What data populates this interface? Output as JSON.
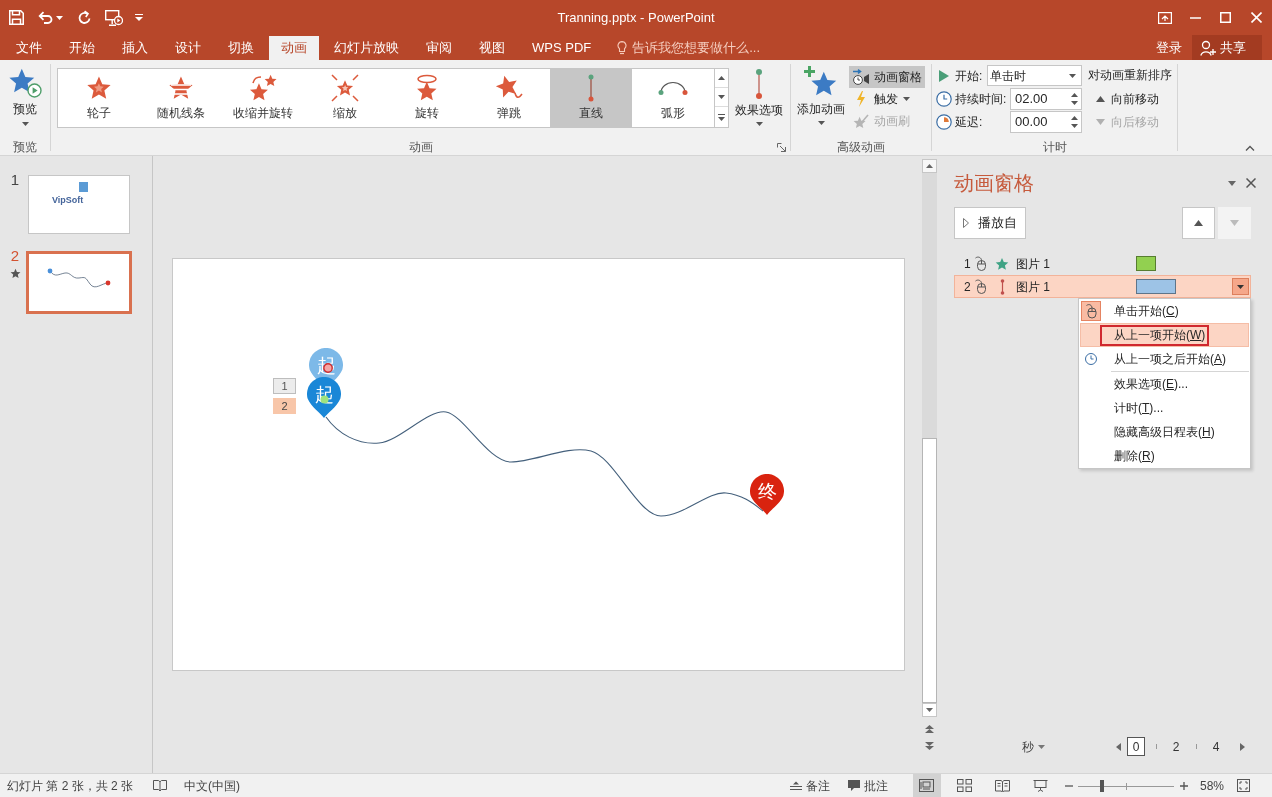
{
  "title_bar": {
    "title": "Tranning.pptx - PowerPoint"
  },
  "tabs": [
    {
      "label": "文件",
      "selected": false
    },
    {
      "label": "开始",
      "selected": false
    },
    {
      "label": "插入",
      "selected": false
    },
    {
      "label": "设计",
      "selected": false
    },
    {
      "label": "切换",
      "selected": false
    },
    {
      "label": "动画",
      "selected": true
    },
    {
      "label": "幻灯片放映",
      "selected": false
    },
    {
      "label": "审阅",
      "selected": false
    },
    {
      "label": "视图",
      "selected": false
    },
    {
      "label": "WPS PDF",
      "selected": false
    }
  ],
  "tell_me": {
    "placeholder": "告诉我您想要做什么..."
  },
  "account": {
    "sign_in": "登录",
    "share": "共享"
  },
  "ribbon": {
    "preview": {
      "button": "预览",
      "group_label": "预览"
    },
    "animation": {
      "effects": [
        {
          "kind": "wheel",
          "label": "轮子",
          "selected": false
        },
        {
          "kind": "bars",
          "label": "随机线条",
          "selected": false
        },
        {
          "kind": "shrink",
          "label": "收缩并旋转",
          "selected": false
        },
        {
          "kind": "zoom",
          "label": "缩放",
          "selected": false
        },
        {
          "kind": "spin",
          "label": "旋转",
          "selected": false
        },
        {
          "kind": "bounce",
          "label": "弹跳",
          "selected": false
        },
        {
          "kind": "line",
          "label": "直线",
          "selected": true
        },
        {
          "kind": "arc",
          "label": "弧形",
          "selected": false
        }
      ],
      "effect_options": "效果选项",
      "group_label": "动画"
    },
    "advanced": {
      "add_animation": "添加动画",
      "tools": [
        {
          "kind": "pane",
          "label": "动画窗格",
          "on": true,
          "disabled": false
        },
        {
          "kind": "trigger",
          "label": "触发",
          "on": false,
          "disabled": false
        },
        {
          "kind": "painter",
          "label": "动画刷",
          "on": false,
          "disabled": true
        }
      ],
      "group_label": "高级动画"
    },
    "timing": {
      "fields": [
        {
          "kind": "start",
          "label": "开始:",
          "value": "单击时"
        },
        {
          "kind": "duration",
          "label": "持续时间:",
          "value": "02.00"
        },
        {
          "kind": "delay",
          "label": "延迟:",
          "value": "00.00"
        }
      ],
      "reorder_title": "对动画重新排序",
      "reorder": [
        {
          "kind": "earlier",
          "label": "向前移动",
          "disabled": false
        },
        {
          "kind": "later",
          "label": "向后移动",
          "disabled": true
        }
      ],
      "group_label": "计时"
    }
  },
  "slides": [
    {
      "number": "1",
      "selected": false,
      "animated": false,
      "kind": "title",
      "text": "VipSoft"
    },
    {
      "number": "2",
      "selected": true,
      "animated": true,
      "kind": "path"
    }
  ],
  "slide": {
    "tags": [
      {
        "number": "1",
        "selected": false
      },
      {
        "number": "2",
        "selected": true
      }
    ],
    "markers": [
      {
        "kind": "start",
        "label": "起",
        "dimmed": true
      },
      {
        "kind": "start",
        "label": "起",
        "dimmed": false
      },
      {
        "kind": "end",
        "label": "终",
        "dimmed": false
      }
    ]
  },
  "animation_pane": {
    "title": "动画窗格",
    "play_from": "播放自",
    "move_up_disabled": false,
    "move_down_disabled": true,
    "items": [
      {
        "number": "1",
        "kind": "emphasis",
        "name": "图片 1",
        "color": "#92d050",
        "level": 0.25,
        "selected": false
      },
      {
        "number": "2",
        "kind": "path",
        "name": "图片 1",
        "color": "#9dc3e6",
        "level": 0.5,
        "selected": true
      }
    ],
    "context_menu": {
      "sections": [
        [
          {
            "kind": "click",
            "text": "单击开始(",
            "key": "C",
            "text_after": ")",
            "checked": true,
            "selected": false,
            "annotated": false
          },
          {
            "kind": "with",
            "text": "从上一项开始(",
            "key": "W",
            "text_after": ")",
            "checked": false,
            "selected": true,
            "annotated": true
          },
          {
            "kind": "after",
            "text": "从上一项之后开始(",
            "key": "A",
            "text_after": ")",
            "checked": false,
            "selected": false,
            "annotated": false
          }
        ],
        [
          {
            "kind": "command",
            "text": "效果选项(",
            "key": "E",
            "text_after": ")...",
            "checked": false,
            "selected": false,
            "annotated": false
          },
          {
            "kind": "command",
            "text": "计时(",
            "key": "T",
            "text_after": ")...",
            "checked": false,
            "selected": false,
            "annotated": false
          },
          {
            "kind": "command",
            "text": "隐藏高级日程表(",
            "key": "H",
            "text_after": ")",
            "checked": false,
            "selected": false,
            "annotated": false
          },
          {
            "kind": "command",
            "text": "删除(",
            "key": "R",
            "text_after": ")",
            "checked": false,
            "selected": false,
            "annotated": false
          }
        ]
      ]
    },
    "timeline": {
      "unit": "秒",
      "ticks": [
        {
          "label": "0",
          "selected": true
        },
        {
          "label": "2",
          "selected": false
        },
        {
          "label": "4",
          "selected": false
        }
      ]
    }
  },
  "status_bar": {
    "slide_info": "幻灯片 第 2 张，共 2 张",
    "language": "中文(中国)",
    "notes": "备注",
    "comments": "批注",
    "views": [
      {
        "kind": "normal",
        "selected": true
      },
      {
        "kind": "sorter",
        "selected": false
      },
      {
        "kind": "reading",
        "selected": false
      },
      {
        "kind": "slideshow",
        "selected": false
      }
    ],
    "zoom": {
      "level": 0.25,
      "reading": "58%"
    }
  }
}
